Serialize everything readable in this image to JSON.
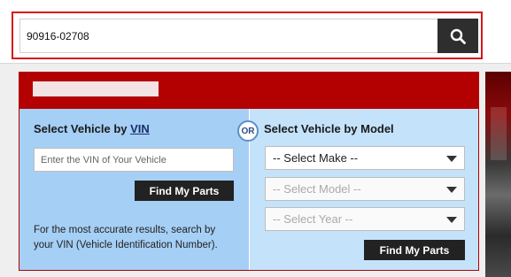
{
  "search": {
    "value": "90916-02708",
    "button_icon": "search-icon"
  },
  "vin_column": {
    "title_prefix": "Select Vehicle by ",
    "title_link": "VIN",
    "input_placeholder": "Enter the VIN of Your Vehicle",
    "button_label": "Find My Parts",
    "help_text": "For the most accurate results, search by your VIN (Vehicle Identification Number)."
  },
  "or_label": "OR",
  "model_column": {
    "title": "Select Vehicle by Model",
    "make_select": "-- Select Make --",
    "model_select": "-- Select Model --",
    "year_select": "-- Select Year --",
    "button_label": "Find My Parts"
  },
  "colors": {
    "accent_red": "#b30000",
    "search_highlight": "#d9141c",
    "left_panel_blue": "#a5cff5",
    "right_panel_blue": "#c4e3fb",
    "button_dark": "#222222"
  }
}
